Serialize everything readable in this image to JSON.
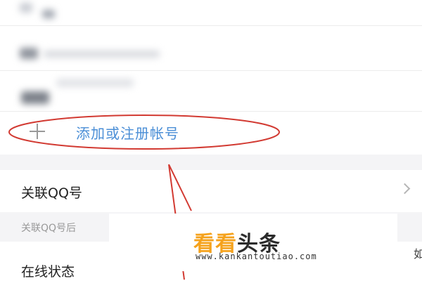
{
  "accounts": {
    "add_label": "添加或注册帐号"
  },
  "settings": {
    "link_qq_label": "关联QQ号",
    "link_qq_hint": "关联QQ号后",
    "online_status_label": "在线状态"
  },
  "watermark": {
    "brand_part1": "看看",
    "brand_part2": "头条",
    "url": "www.kankantoutiao.com"
  },
  "edge_text": "如",
  "colors": {
    "accent_blue": "#4a8ed6",
    "annotation_red": "#d23a32",
    "watermark_orange": "#f5a21c"
  }
}
